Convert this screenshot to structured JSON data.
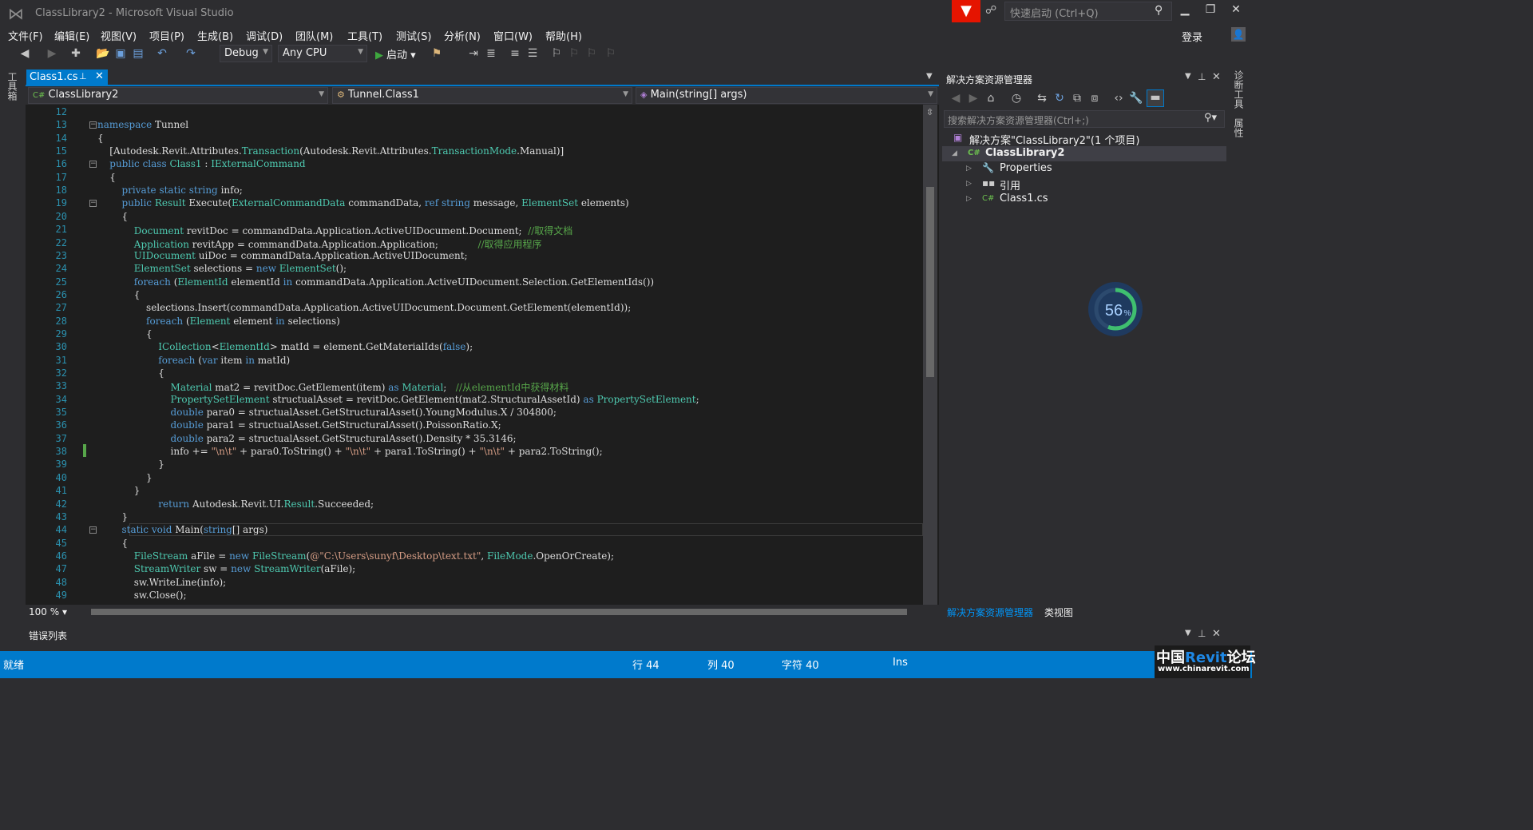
{
  "window": {
    "title": "ClassLibrary2 - Microsoft Visual Studio",
    "quick_launch_placeholder": "快速启动 (Ctrl+Q)",
    "login": "登录"
  },
  "menu": [
    "文件(F)",
    "编辑(E)",
    "视图(V)",
    "项目(P)",
    "生成(B)",
    "调试(D)",
    "团队(M)",
    "工具(T)",
    "测试(S)",
    "分析(N)",
    "窗口(W)",
    "帮助(H)"
  ],
  "toolbar": {
    "config": "Debug",
    "platform": "Any CPU",
    "start_label": "启动"
  },
  "side": {
    "left": "工具箱",
    "right_top": "诊断工具",
    "right_bottom": "属性"
  },
  "tabs": [
    {
      "label": "Class1.cs"
    }
  ],
  "nav": {
    "project": "ClassLibrary2",
    "type": "Tunnel.Class1",
    "member": "Main(string[] args)"
  },
  "editor": {
    "zoom": "100 %"
  },
  "code_lines": [
    {
      "n": "12",
      "html": ""
    },
    {
      "n": "13",
      "html": "<span class=\"kw\">namespace</span> Tunnel"
    },
    {
      "n": "14",
      "html": "{"
    },
    {
      "n": "15",
      "html": "    [Autodesk.Revit.Attributes.<span class=\"ty\">Transaction</span>(Autodesk.Revit.Attributes.<span class=\"ty\">TransactionMode</span>.Manual)]"
    },
    {
      "n": "16",
      "html": "    <span class=\"kw\">public class</span> <span class=\"ty\">Class1</span> : <span class=\"ty\">IExternalCommand</span>"
    },
    {
      "n": "17",
      "html": "    {"
    },
    {
      "n": "18",
      "html": "        <span class=\"kw\">private static string</span> info;"
    },
    {
      "n": "19",
      "html": "        <span class=\"kw\">public</span> <span class=\"ty\">Result</span> Execute(<span class=\"ty\">ExternalCommandData</span> commandData, <span class=\"kw\">ref string</span> message, <span class=\"ty\">ElementSet</span> elements)"
    },
    {
      "n": "20",
      "html": "        {"
    },
    {
      "n": "21",
      "html": "            <span class=\"ty\">Document</span> revitDoc = commandData.Application.ActiveUIDocument.Document;  <span class=\"cm\">//取得文档</span>"
    },
    {
      "n": "22",
      "html": "            <span class=\"ty\">Application</span> revitApp = commandData.Application.Application;             <span class=\"cm\">//取得应用程序</span>"
    },
    {
      "n": "23",
      "html": "            <span class=\"ty\">UIDocument</span> uiDoc = commandData.Application.ActiveUIDocument;"
    },
    {
      "n": "24",
      "html": "            <span class=\"ty\">ElementSet</span> selections = <span class=\"kw\">new</span> <span class=\"ty\">ElementSet</span>();"
    },
    {
      "n": "25",
      "html": "            <span class=\"kw\">foreach</span> (<span class=\"ty\">ElementId</span> elementId <span class=\"kw\">in</span> commandData.Application.ActiveUIDocument.Selection.GetElementIds())"
    },
    {
      "n": "26",
      "html": "            {"
    },
    {
      "n": "27",
      "html": "                selections.Insert(commandData.Application.ActiveUIDocument.Document.GetElement(elementId));"
    },
    {
      "n": "28",
      "html": "                <span class=\"kw\">foreach</span> (<span class=\"ty\">Element</span> element <span class=\"kw\">in</span> selections)"
    },
    {
      "n": "29",
      "html": "                {"
    },
    {
      "n": "30",
      "html": "                    <span class=\"ty\">ICollection</span>&lt;<span class=\"ty\">ElementId</span>&gt; matId = element.GetMaterialIds(<span class=\"kw\">false</span>);"
    },
    {
      "n": "31",
      "html": "                    <span class=\"kw\">foreach</span> (<span class=\"kw\">var</span> item <span class=\"kw\">in</span> matId)"
    },
    {
      "n": "32",
      "html": "                    {"
    },
    {
      "n": "33",
      "html": "                        <span class=\"ty\">Material</span> mat2 = revitDoc.GetElement(item) <span class=\"kw\">as</span> <span class=\"ty\">Material</span>;   <span class=\"cm\">//从elementId中获得材料</span>"
    },
    {
      "n": "34",
      "html": "                        <span class=\"ty\">PropertySetElement</span> structualAsset = revitDoc.GetElement(mat2.StructuralAssetId) <span class=\"kw\">as</span> <span class=\"ty\">PropertySetElement</span>;"
    },
    {
      "n": "35",
      "html": "                        <span class=\"kw\">double</span> para0 = structualAsset.GetStructuralAsset().YoungModulus.X / 304800;"
    },
    {
      "n": "36",
      "html": "                        <span class=\"kw\">double</span> para1 = structualAsset.GetStructuralAsset().PoissonRatio.X;"
    },
    {
      "n": "37",
      "html": "                        <span class=\"kw\">double</span> para2 = structualAsset.GetStructuralAsset().Density * 35.3146;"
    },
    {
      "n": "38",
      "html": "                        info += <span class=\"st\">\"\\n\\t\"</span> + para0.ToString() + <span class=\"st\">\"\\n\\t\"</span> + para1.ToString() + <span class=\"st\">\"\\n\\t\"</span> + para2.ToString();"
    },
    {
      "n": "39",
      "html": "                    }"
    },
    {
      "n": "40",
      "html": "                }"
    },
    {
      "n": "41",
      "html": "            }"
    },
    {
      "n": "42",
      "html": "                    <span class=\"kw\">return</span> Autodesk.Revit.UI.<span class=\"ty\">Result</span>.Succeeded;"
    },
    {
      "n": "43",
      "html": "        }"
    },
    {
      "n": "44",
      "html": "        <span class=\"kw\">static void</span> Main(<span class=\"kw\">string</span>[] args)"
    },
    {
      "n": "45",
      "html": "        {"
    },
    {
      "n": "46",
      "html": "            <span class=\"ty\">FileStream</span> aFile = <span class=\"kw\">new</span> <span class=\"ty\">FileStream</span>(<span class=\"st\">@\"C:\\Users\\sunyf\\Desktop\\text.txt\"</span>, <span class=\"ty\">FileMode</span>.OpenOrCreate);"
    },
    {
      "n": "47",
      "html": "            <span class=\"ty\">StreamWriter</span> sw = <span class=\"kw\">new</span> <span class=\"ty\">StreamWriter</span>(aFile);"
    },
    {
      "n": "48",
      "html": "            sw.WriteLine(info);"
    },
    {
      "n": "49",
      "html": "            sw.Close();"
    }
  ],
  "solution": {
    "title": "解决方案资源管理器",
    "search_placeholder": "搜索解决方案资源管理器(Ctrl+;)",
    "items": [
      {
        "label": "解决方案\"ClassLibrary2\"(1 个项目)",
        "icon": "solution-icon"
      },
      {
        "label": "ClassLibrary2",
        "icon": "csharp-project-icon"
      },
      {
        "label": "Properties",
        "icon": "wrench-icon"
      },
      {
        "label": "引用",
        "icon": "references-icon"
      },
      {
        "label": "Class1.cs",
        "icon": "csharp-file-icon"
      }
    ],
    "tab_solution": "解决方案资源管理器",
    "tab_class": "类视图",
    "progress": "56",
    "progress_unit": "%"
  },
  "errors": {
    "title": "错误列表"
  },
  "status": {
    "ready": "就绪",
    "line": "行 44",
    "col": "列 40",
    "char": "字符 40",
    "ins": "Ins"
  },
  "watermark": {
    "brand_cn": "中国",
    "brand_revit": "Revit",
    "brand_forum": "论坛",
    "url": "www.chinarevit.com"
  },
  "colors": {
    "accent": "#007acc",
    "editor_bg": "#1e1e1e",
    "keyword": "#569cd6",
    "type": "#4ec9b0",
    "comment": "#57a64a",
    "filter": "#e51400"
  }
}
